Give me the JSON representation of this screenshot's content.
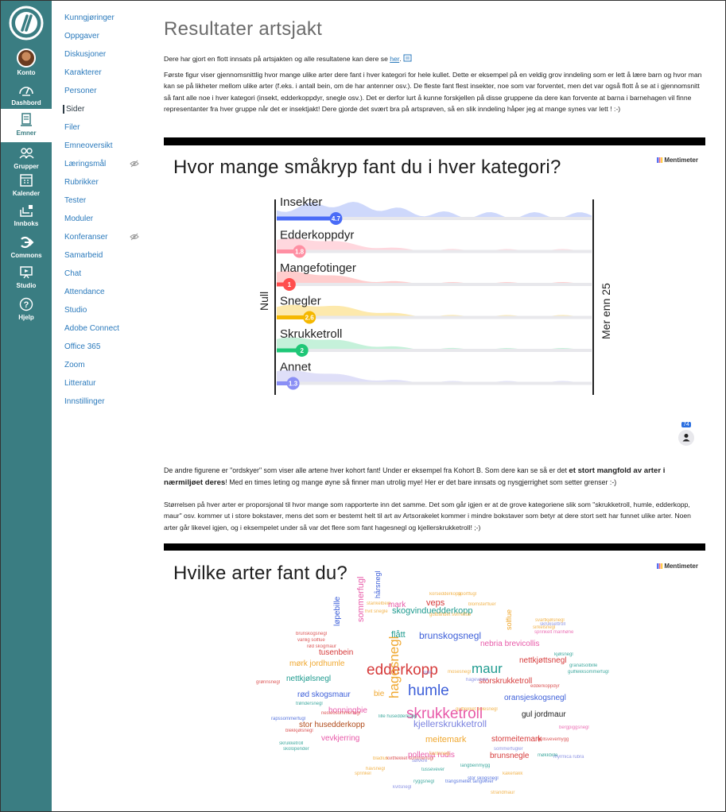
{
  "global_nav": {
    "items": [
      {
        "label": "Konto",
        "icon": "avatar"
      },
      {
        "label": "Dashbord",
        "icon": "dashboard-icon"
      },
      {
        "label": "Emner",
        "icon": "courses-icon",
        "active": true
      },
      {
        "label": "Grupper",
        "icon": "groups-icon"
      },
      {
        "label": "Kalender",
        "icon": "calendar-icon"
      },
      {
        "label": "Innboks",
        "icon": "inbox-icon"
      },
      {
        "label": "Commons",
        "icon": "commons-icon"
      },
      {
        "label": "Studio",
        "icon": "studio-icon"
      },
      {
        "label": "Hjelp",
        "icon": "help-icon"
      }
    ]
  },
  "course_nav": {
    "items": [
      {
        "label": "Kunngjøringer"
      },
      {
        "label": "Oppgaver"
      },
      {
        "label": "Diskusjoner"
      },
      {
        "label": "Karakterer"
      },
      {
        "label": "Personer"
      },
      {
        "label": "Sider",
        "active": true
      },
      {
        "label": "Filer"
      },
      {
        "label": "Emneoversikt"
      },
      {
        "label": "Læringsmål",
        "hidden_icon": true
      },
      {
        "label": "Rubrikker"
      },
      {
        "label": "Tester"
      },
      {
        "label": "Moduler"
      },
      {
        "label": "Konferanser",
        "hidden_icon": true
      },
      {
        "label": "Samarbeid"
      },
      {
        "label": "Chat"
      },
      {
        "label": "Attendance"
      },
      {
        "label": "Studio"
      },
      {
        "label": "Adobe Connect"
      },
      {
        "label": "Office 365"
      },
      {
        "label": "Zoom"
      },
      {
        "label": "Litteratur"
      },
      {
        "label": "Innstillinger"
      }
    ]
  },
  "page": {
    "title": "Resultater artsjakt",
    "intro_before_link": "Dere har gjort en flott innsats på artsjakten og alle resultatene kan dere se ",
    "intro_link": "her",
    "intro_after_link": ".",
    "para1": "Første figur viser gjennomsnittlig hvor mange ulike arter dere fant i hver kategori for hele kullet. Dette er eksempel på en veldig grov inndeling som er lett å lære barn og hvor man kan se på likheter mellom ulike arter (f.eks. i antall bein, om de har antenner osv.). De fleste fant flest insekter, noe som var forventet, men det var også flott å se at i gjennomsnitt så fant alle noe i hver kategori (insekt, edderkoppdyr, snegle osv.). Det er derfor lurt å kunne forskjellen på disse gruppene da dere kan forvente at barna i barnehagen vil finne representanter fra hver gruppe når det er insektjakt! Dere gjorde det svært bra på artsprøven, så en slik inndeling håper jeg at mange synes var lett ! :-)",
    "para2_a": "De andre figurene er \"ordskyer\" som viser alle artene hver kohort fant! Under er eksempel fra Kohort B. Som dere kan se så er det ",
    "para2_bold": "et stort mangfold av arter i nærmiljøet deres",
    "para2_b": "! Med en  times leting og mange øyne så finner man utrolig mye! Her er det bare innsats og nysgjerrighet som setter grenser :-)",
    "para3": "Størrelsen på hver arter er proporsjonal til hvor mange som rapporterte inn det samme. Det som går igjen er at de grove kategoriene slik som \"skrukketroll, humle, edderkopp, maur\" osv. kommer ut i store bokstaver, mens det som er bestemt helt til art av Artsorakelet kommer i mindre bokstaver som betyr at dere stort sett har funnet ulike arter. Noen arter går likevel igjen, og i eksempelet under så var det flere som fant hagesnegl og kjellerskrukketroll! ;-)"
  },
  "slide1": {
    "title": "Hvor mange småkryp fant du i hver kategori?",
    "brand": "Mentimeter",
    "participants": "74"
  },
  "chart_data": {
    "type": "bar",
    "title": "Hvor mange småkryp fant du i hver kategori?",
    "scale_min_label": "Null",
    "scale_max_label": "Mer enn 25",
    "xlim": [
      0,
      25
    ],
    "categories": [
      "Insekter",
      "Edderkoppdyr",
      "Mangefotinger",
      "Snegler",
      "Skrukketroll",
      "Annet"
    ],
    "values": [
      4.7,
      1.8,
      1,
      2.6,
      2,
      1.3
    ],
    "value_labels": [
      "4.7",
      "1.8",
      "1",
      "2.6",
      "2",
      "1.3"
    ],
    "colors": [
      "#4a6cf7",
      "#ff8fa3",
      "#ff4d4d",
      "#f5b800",
      "#1fc777",
      "#8a8ff5"
    ],
    "fill_colors": [
      "#c9d4fb",
      "#ffd3da",
      "#ffc8c8",
      "#fde7a3",
      "#bff0d6",
      "#dcdcf7"
    ]
  },
  "slide2": {
    "title": "Hvilke arter fant du?",
    "brand": "Mentimeter",
    "words": [
      {
        "t": "edderkopp",
        "s": 19,
        "c": "#d63a3a"
      },
      {
        "t": "maur",
        "s": 17,
        "c": "#1f9b8f"
      },
      {
        "t": "humle",
        "s": 19,
        "c": "#3d5fd9"
      },
      {
        "t": "skrukketroll",
        "s": 19,
        "c": "#e85aa9"
      },
      {
        "t": "hagesnegl",
        "s": 17,
        "c": "#f0a830",
        "v": true
      },
      {
        "t": "sommerfugl",
        "s": 11,
        "c": "#e85aa9",
        "v": true
      },
      {
        "t": "brunskogsnegl",
        "s": 12,
        "c": "#3d5fd9"
      },
      {
        "t": "skogvinduedderkopp",
        "s": 11,
        "c": "#1f9b8f"
      },
      {
        "t": "flått",
        "s": 11,
        "c": "#1f9b8f"
      },
      {
        "t": "veps",
        "s": 11,
        "c": "#d63a3a"
      },
      {
        "t": "mark",
        "s": 10,
        "c": "#e85aa9"
      },
      {
        "t": "nebria brevicollis",
        "s": 10,
        "c": "#e85aa9"
      },
      {
        "t": "nettkjøttsnegl",
        "s": 10,
        "c": "#d63a3a"
      },
      {
        "t": "storskrukketroll",
        "s": 10,
        "c": "#d63a3a"
      },
      {
        "t": "oransjeskogsnegl",
        "s": 10,
        "c": "#3d5fd9"
      },
      {
        "t": "gul jordmaur",
        "s": 10,
        "c": "#1d1d1d"
      },
      {
        "t": "kjellerskrukketroll",
        "s": 12,
        "c": "#7b83e0"
      },
      {
        "t": "meitemark",
        "s": 11,
        "c": "#f0a830"
      },
      {
        "t": "stormeitemark",
        "s": 10,
        "c": "#d63a3a"
      },
      {
        "t": "brunsnegle",
        "s": 10,
        "c": "#d63a3a"
      },
      {
        "t": "pollenia rudis",
        "s": 10,
        "c": "#e85aa9"
      },
      {
        "t": "vevkjerring",
        "s": 10,
        "c": "#e85aa9"
      },
      {
        "t": "stor husedderkopp",
        "s": 10,
        "c": "#b04a1a"
      },
      {
        "t": "honningbie",
        "s": 10,
        "c": "#e85aa9"
      },
      {
        "t": "bie",
        "s": 10,
        "c": "#f0a830"
      },
      {
        "t": "rød skogsmaur",
        "s": 10,
        "c": "#3d5fd9"
      },
      {
        "t": "nettkjølsnegl",
        "s": 10,
        "c": "#1f9b8f"
      },
      {
        "t": "mørk jordhumle",
        "s": 10,
        "c": "#f0a830"
      },
      {
        "t": "tusenbein",
        "s": 10,
        "c": "#d63a3a"
      },
      {
        "t": "løpebille",
        "s": 10,
        "c": "#3d5fd9",
        "v": true
      },
      {
        "t": "solflue",
        "s": 9,
        "c": "#f0a830",
        "v": true
      },
      {
        "t": "hårsnegl",
        "s": 9,
        "c": "#3d5fd9",
        "v": true
      },
      {
        "t": "bille",
        "s": 6,
        "c": "#7b83e0"
      },
      {
        "t": "mosesnegl",
        "s": 6,
        "c": "#f0a830"
      },
      {
        "t": "brunskogsnegl",
        "s": 6,
        "c": "#d63a3a"
      },
      {
        "t": "vanlig solflue",
        "s": 6,
        "c": "#d63a3a"
      },
      {
        "t": "rød skogmaur",
        "s": 6,
        "c": "#d63a3a"
      },
      {
        "t": "trøndersnegl",
        "s": 6,
        "c": "#1f9b8f"
      },
      {
        "t": "gulflekket bolesnegl",
        "s": 6,
        "c": "#f0a830"
      },
      {
        "t": "sprinkelt marihøne",
        "s": 6,
        "c": "#e85aa9"
      },
      {
        "t": "svartkjølsnegl",
        "s": 6,
        "c": "#f0a830"
      },
      {
        "t": "sirkelsnegl",
        "s": 6,
        "c": "#f0a830"
      },
      {
        "t": "skruksettroll",
        "s": 6,
        "c": "#7b83e0"
      },
      {
        "t": "stankelbein",
        "s": 6,
        "c": "#f0a830"
      },
      {
        "t": "granatsolbille",
        "s": 6,
        "c": "#1f9b8f"
      },
      {
        "t": "gulflekksommerfugl",
        "s": 6,
        "c": "#1f9b8f"
      },
      {
        "t": "bergpiggsnegl",
        "s": 6,
        "c": "#e85aa9"
      },
      {
        "t": "fjellsvevemygg",
        "s": 6,
        "c": "#d63a3a"
      },
      {
        "t": "møkkbille",
        "s": 6,
        "c": "#1f9b8f"
      },
      {
        "t": "myrmica rubra",
        "s": 6,
        "c": "#7b83e0"
      },
      {
        "t": "kjølsnegl",
        "s": 6,
        "c": "#1f9b8f"
      },
      {
        "t": "blomsterfluer",
        "s": 6,
        "c": "#f0a830"
      },
      {
        "t": "sportfugl",
        "s": 6,
        "c": "#f0a830"
      },
      {
        "t": "korsedderkopp",
        "s": 6,
        "c": "#f0a830"
      },
      {
        "t": "lille husedderkopp",
        "s": 6,
        "c": "#1f9b8f"
      },
      {
        "t": "kantsnegl",
        "s": 6,
        "c": "#f0a830"
      },
      {
        "t": "sommerfugler",
        "s": 6,
        "c": "#7b83e0"
      },
      {
        "t": "kakerlakk",
        "s": 6,
        "c": "#f0a830"
      },
      {
        "t": "edderkoppdyr",
        "s": 6,
        "c": "#d63a3a"
      },
      {
        "t": "langbeinmygg",
        "s": 6,
        "c": "#1f9b8f"
      },
      {
        "t": "trangsmellet tangvever",
        "s": 6,
        "c": "#3d5fd9"
      },
      {
        "t": "sølvkre",
        "s": 6,
        "c": "#7b83e0"
      },
      {
        "t": "tussevever",
        "s": 6,
        "c": "#1f9b8f"
      },
      {
        "t": "kvitflekket sommerfugl",
        "s": 6,
        "c": "#d63a3a"
      },
      {
        "t": "hvit snegle",
        "s": 6,
        "c": "#f0a830"
      },
      {
        "t": "nesleosommerfugl",
        "s": 6,
        "c": "#d63a3a"
      },
      {
        "t": "rapssommerfugl",
        "s": 6,
        "c": "#3d5fd9"
      },
      {
        "t": "blekkjølsnegl",
        "s": 6,
        "c": "#d63a3a"
      },
      {
        "t": "skrukketroll",
        "s": 6,
        "c": "#1f9b8f"
      },
      {
        "t": "bladlus",
        "s": 6,
        "c": "#f0a830"
      },
      {
        "t": "gulbåndet svirreflue",
        "s": 6,
        "c": "#f0a830"
      },
      {
        "t": "hagevever",
        "s": 6,
        "c": "#7b83e0"
      },
      {
        "t": "skolopender",
        "s": 6,
        "c": "#1f9b8f"
      },
      {
        "t": "grønnsnegl",
        "s": 6,
        "c": "#d63a3a"
      },
      {
        "t": "sprinkel",
        "s": 6,
        "c": "#f0a830"
      },
      {
        "t": "havsnegl",
        "s": 6,
        "c": "#f0a830"
      },
      {
        "t": "kvitsnegl",
        "s": 6,
        "c": "#7b83e0"
      },
      {
        "t": "stor skogsnegl",
        "s": 6,
        "c": "#3d5fd9"
      },
      {
        "t": "ryggsnegl",
        "s": 6,
        "c": "#1f9b8f"
      },
      {
        "t": "strandmaur",
        "s": 6,
        "c": "#f0a830"
      }
    ]
  }
}
